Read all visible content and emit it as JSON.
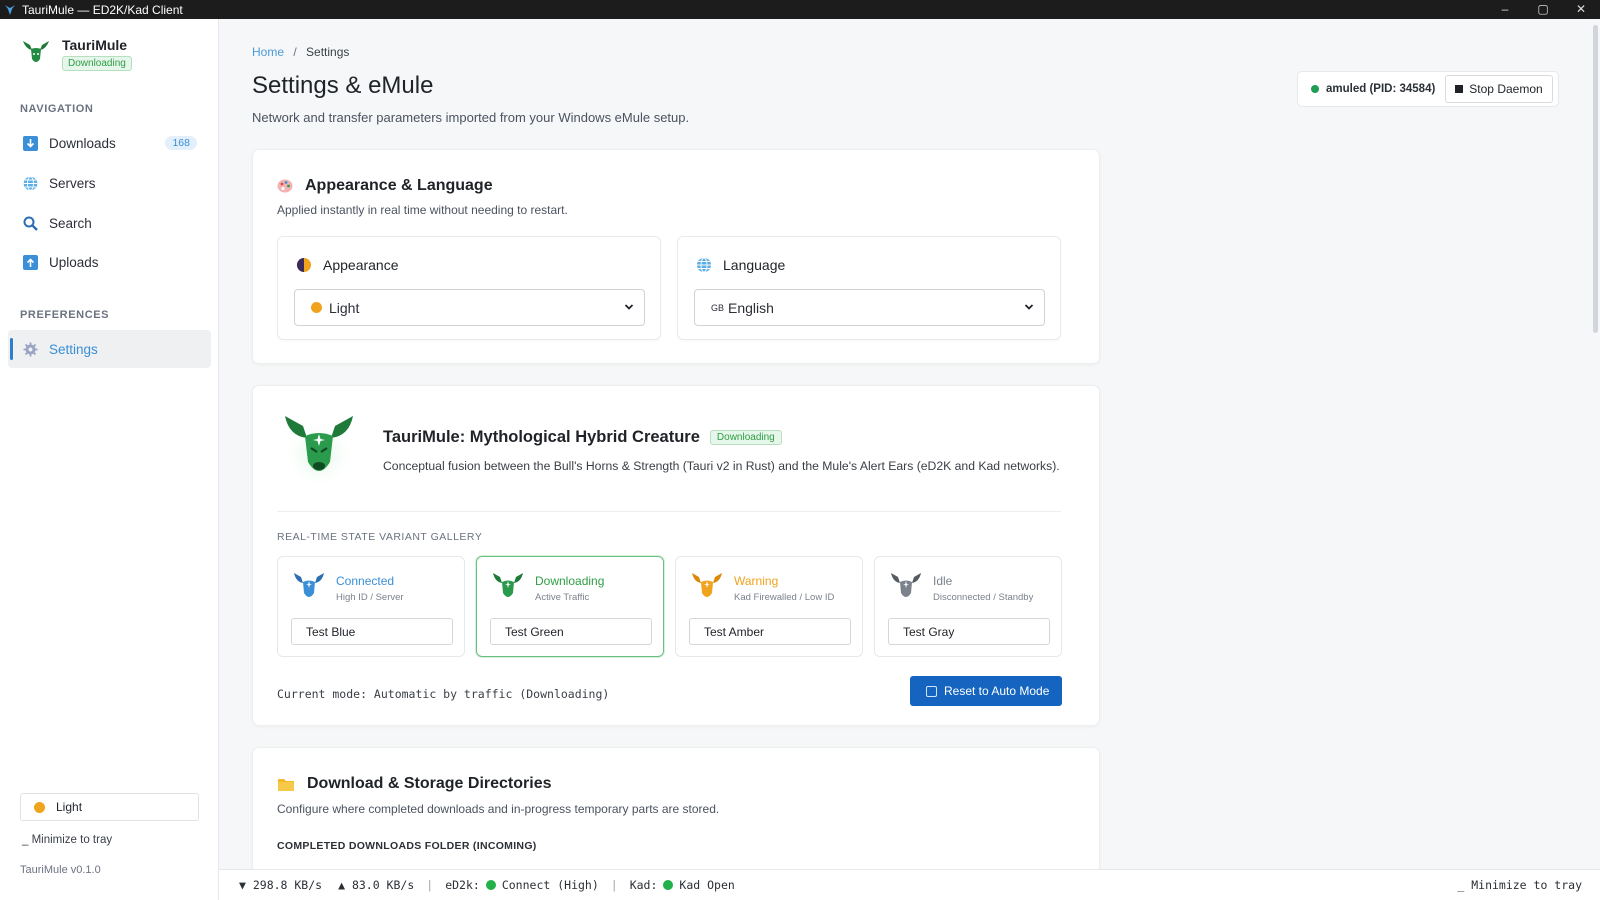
{
  "window": {
    "title": "TauriMule — ED2K/Kad Client",
    "controls": [
      "–",
      "▢",
      "✕"
    ]
  },
  "sidebar": {
    "brand_name": "TauriMule",
    "brand_status": "Downloading",
    "nav_label": "NAVIGATION",
    "items": [
      {
        "label": "Downloads",
        "icon": "download-icon",
        "badge": "168"
      },
      {
        "label": "Servers",
        "icon": "globe-icon"
      },
      {
        "label": "Search",
        "icon": "search-icon"
      },
      {
        "label": "Uploads",
        "icon": "upload-icon"
      }
    ],
    "prefs_label": "PREFERENCES",
    "settings_label": "Settings",
    "theme_toggle": "Light",
    "minimize": "_  Minimize to tray",
    "version": "TauriMule v0.1.0"
  },
  "breadcrumb": {
    "home": "Home",
    "sep": "/",
    "current": "Settings"
  },
  "page": {
    "title": "Settings & eMule",
    "subtitle": "Network and transfer parameters imported from your Windows eMule setup."
  },
  "daemon": {
    "status": "amuled (PID: 34584)",
    "stop_label": "Stop Daemon",
    "status_color": "#1f9d55"
  },
  "appearance_card": {
    "title": "Appearance & Language",
    "desc": "Applied instantly in real time without needing to restart.",
    "appearance_label": "Appearance",
    "appearance_value": "Light",
    "language_label": "Language",
    "language_flag": "GB",
    "language_value": "English"
  },
  "hero_card": {
    "title": "TauriMule: Mythological Hybrid Creature",
    "badge": "Downloading",
    "desc": "Conceptual fusion between the Bull's Horns & Strength (Tauri v2 in Rust) and the Mule's Alert Ears (eD2K and Kad networks).",
    "gallery_label": "REAL-TIME STATE VARIANT GALLERY",
    "variants": [
      {
        "name": "Connected",
        "sub": "High ID / Server",
        "button": "Test Blue",
        "color": "#3a8fd6"
      },
      {
        "name": "Downloading",
        "sub": "Active Traffic",
        "button": "Test Green",
        "color": "#2f9e44"
      },
      {
        "name": "Warning",
        "sub": "Kad Firewalled / Low ID",
        "button": "Test Amber",
        "color": "#f0a31c"
      },
      {
        "name": "Idle",
        "sub": "Disconnected / Standby",
        "button": "Test Gray",
        "color": "#7b828c"
      }
    ],
    "mode_text": "Current mode: Automatic by traffic (Downloading)",
    "reset_label": "Reset to Auto Mode"
  },
  "storage_card": {
    "title": "Download & Storage Directories",
    "desc": "Configure where completed downloads and in-progress temporary parts are stored.",
    "incoming_label": "COMPLETED DOWNLOADS FOLDER (INCOMING)"
  },
  "statusbar": {
    "down": "▼ 298.8 KB/s",
    "up": "▲ 83.0 KB/s",
    "ed2k_label": "eD2k:",
    "ed2k_value": "Connect (High)",
    "kad_label": "Kad:",
    "kad_value": "Kad Open",
    "tray": "_ Minimize to tray"
  },
  "colors": {
    "accent": "#1565c0",
    "link": "#4a9ad8",
    "success": "#22b04a"
  }
}
